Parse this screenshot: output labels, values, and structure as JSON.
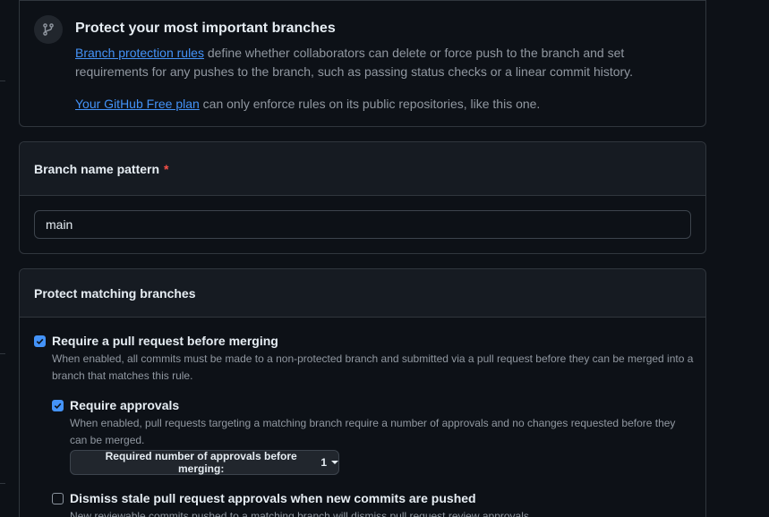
{
  "info": {
    "title": "Protect your most important branches",
    "rules_link": "Branch protection rules",
    "rules_text": " define whether collaborators can delete or force push to the branch and set requirements for any pushes to the branch, such as passing status checks or a linear commit history.",
    "plan_link": "Your GitHub Free plan",
    "plan_text": " can only enforce rules on its public repositories, like this one."
  },
  "pattern": {
    "label": "Branch name pattern",
    "required_mark": "*",
    "value": "main"
  },
  "protect": {
    "header": "Protect matching branches",
    "options": [
      {
        "title": "Require a pull request before merging",
        "checked": true,
        "description": "When enabled, all commits must be made to a non-protected branch and submitted via a pull request before they can be merged into a branch that matches this rule."
      },
      {
        "title": "Require approvals",
        "checked": true,
        "description": "When enabled, pull requests targeting a matching branch require a number of approvals and no changes requested before they can be merged."
      },
      {
        "title": "Dismiss stale pull request approvals when new commits are pushed",
        "checked": false,
        "description": "New reviewable commits pushed to a matching branch will dismiss pull request review approvals."
      }
    ],
    "approvals_dropdown": {
      "label": "Required number of approvals before merging: ",
      "value": "1"
    }
  },
  "colors": {
    "background": "#0d1117",
    "border": "#30363d",
    "link": "#4493f8",
    "checkbox_checked": "#4493f8",
    "required": "#f85149"
  }
}
